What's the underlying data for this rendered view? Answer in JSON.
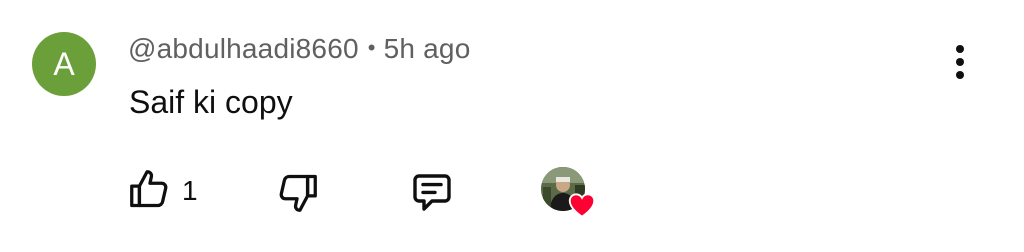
{
  "comment": {
    "avatar_letter": "A",
    "avatar_color": "#6a9f3a",
    "username": "@abdulhaadi8660",
    "separator": "•",
    "timestamp": "5h ago",
    "text": "Saif ki copy"
  },
  "actions": {
    "like_icon": "thumbs-up-icon",
    "like_count": "1",
    "dislike_icon": "thumbs-down-icon",
    "reply_icon": "reply-comment-icon",
    "creator_heart_icon": "heart-icon",
    "heart_color": "#ff0033",
    "more_icon": "more-vertical-icon"
  }
}
